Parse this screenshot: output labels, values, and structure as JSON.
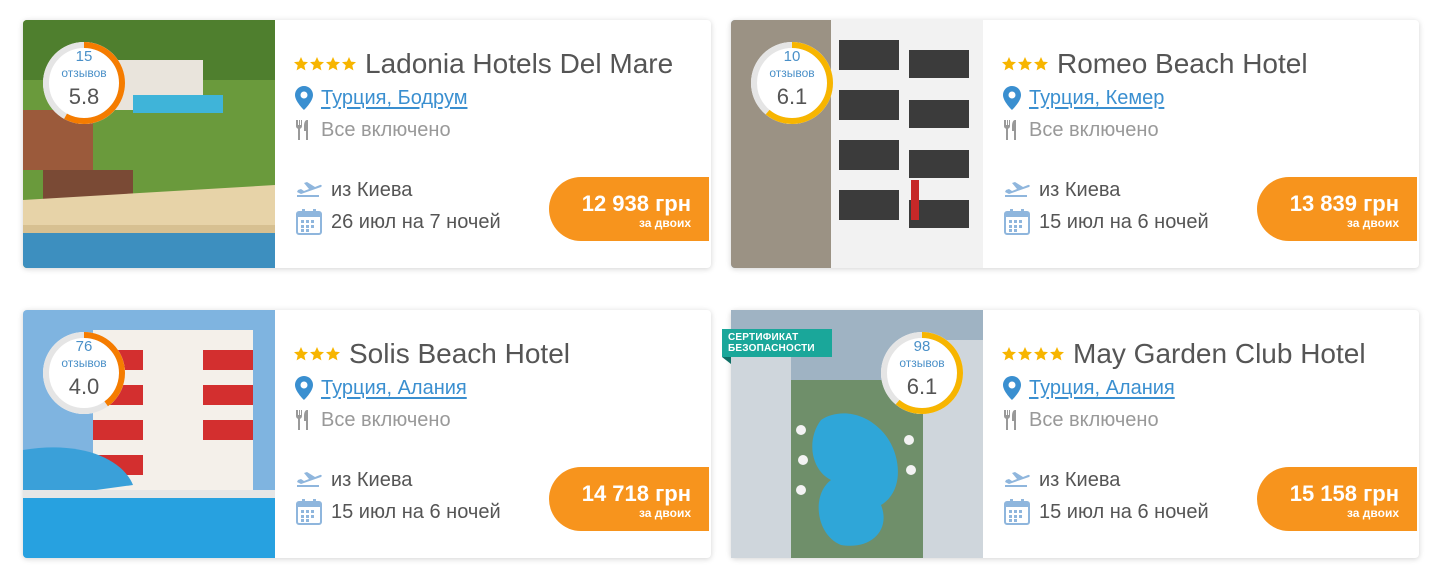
{
  "cards": [
    {
      "reviews_count": "15",
      "reviews_label": "отзывов",
      "score": "5.8",
      "score_fraction": 0.58,
      "ring_color": "#f57c00",
      "stars": 4,
      "name": "Ladonia Hotels Del Mare",
      "location": "Турция, Бодрум",
      "meal": "Все включено",
      "departure": "из Киева",
      "dates": "26 июл на 7 ночей",
      "price": "12 938 грн",
      "price_note": "за двоих"
    },
    {
      "reviews_count": "10",
      "reviews_label": "отзывов",
      "score": "6.1",
      "score_fraction": 0.61,
      "ring_color": "#f7b500",
      "stars": 3,
      "name": "Romeo Beach Hotel",
      "location": "Турция, Кемер",
      "meal": "Все включено",
      "departure": "из Киева",
      "dates": "15 июл на 6 ночей",
      "price": "13 839 грн",
      "price_note": "за двоих"
    },
    {
      "reviews_count": "76",
      "reviews_label": "отзывов",
      "score": "4.0",
      "score_fraction": 0.4,
      "ring_color": "#f57c00",
      "stars": 3,
      "name": "Solis Beach Hotel",
      "location": "Турция, Алания",
      "meal": "Все включено",
      "departure": "из Киева",
      "dates": "15 июл на 6 ночей",
      "price": "14 718 грн",
      "price_note": "за двоих"
    },
    {
      "reviews_count": "98",
      "reviews_label": "отзывов",
      "score": "6.1",
      "score_fraction": 0.61,
      "ring_color": "#f7b500",
      "stars": 4,
      "name": "May Garden Club Hotel",
      "location": "Турция, Алания",
      "meal": "Все включено",
      "departure": "из Киева",
      "dates": "15 июл на 6 ночей",
      "price": "15 158 грн",
      "price_note": "за двоих",
      "badge": "СЕРТИФИКАТ БЕЗОПАСНОСТИ"
    }
  ],
  "icons": {
    "location": "map-pin-icon",
    "meal": "fork-knife-icon",
    "departure": "airplane-icon",
    "dates": "calendar-icon",
    "star": "star-icon"
  },
  "colors": {
    "accent": "#f7941d",
    "link": "#3a8fd0",
    "icon": "#8fb6dd",
    "star": "#f7b500",
    "badge": "#1aa79a"
  }
}
